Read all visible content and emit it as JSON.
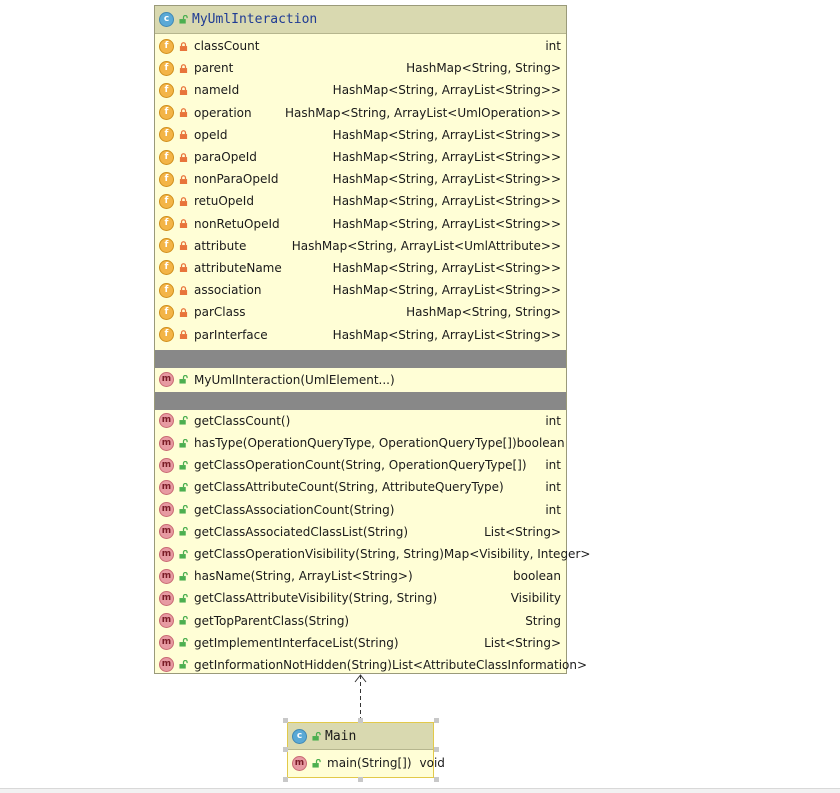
{
  "classes": [
    {
      "title": "MyUmlInteraction",
      "fields": [
        {
          "name": "classCount",
          "type": "int"
        },
        {
          "name": "parent",
          "type": "HashMap<String, String>"
        },
        {
          "name": "nameId",
          "type": "HashMap<String, ArrayList<String>>"
        },
        {
          "name": "operation",
          "type": "HashMap<String, ArrayList<UmlOperation>>"
        },
        {
          "name": "opeId",
          "type": "HashMap<String, ArrayList<String>>"
        },
        {
          "name": "paraOpeId",
          "type": "HashMap<String, ArrayList<String>>"
        },
        {
          "name": "nonParaOpeId",
          "type": "HashMap<String, ArrayList<String>>"
        },
        {
          "name": "retuOpeId",
          "type": "HashMap<String, ArrayList<String>>"
        },
        {
          "name": "nonRetuOpeId",
          "type": "HashMap<String, ArrayList<String>>"
        },
        {
          "name": "attribute",
          "type": "HashMap<String, ArrayList<UmlAttribute>>"
        },
        {
          "name": "attributeName",
          "type": "HashMap<String, ArrayList<String>>"
        },
        {
          "name": "association",
          "type": "HashMap<String, ArrayList<String>>"
        },
        {
          "name": "parClass",
          "type": "HashMap<String, String>"
        },
        {
          "name": "parInterface",
          "type": "HashMap<String, ArrayList<String>>"
        }
      ],
      "constructors": [
        {
          "name": "MyUmlInteraction(UmlElement...)",
          "type": ""
        }
      ],
      "methods": [
        {
          "name": "getClassCount()",
          "type": "int"
        },
        {
          "name": "hasType(OperationQueryType, OperationQueryType[])",
          "type": "boolean"
        },
        {
          "name": "getClassOperationCount(String, OperationQueryType[])",
          "type": "int"
        },
        {
          "name": "getClassAttributeCount(String, AttributeQueryType)",
          "type": "int"
        },
        {
          "name": "getClassAssociationCount(String)",
          "type": "int"
        },
        {
          "name": "getClassAssociatedClassList(String)",
          "type": "List<String>"
        },
        {
          "name": "getClassOperationVisibility(String, String)",
          "type": "Map<Visibility, Integer>"
        },
        {
          "name": "hasName(String, ArrayList<String>)",
          "type": "boolean"
        },
        {
          "name": "getClassAttributeVisibility(String, String)",
          "type": "Visibility"
        },
        {
          "name": "getTopParentClass(String)",
          "type": "String"
        },
        {
          "name": "getImplementInterfaceList(String)",
          "type": "List<String>"
        },
        {
          "name": "getInformationNotHidden(String)",
          "type": "List<AttributeClassInformation>"
        }
      ]
    },
    {
      "title": "Main",
      "methods": [
        {
          "name": "main(String[])",
          "type": "void"
        }
      ]
    }
  ],
  "badges": {
    "class": "c",
    "field": "f",
    "method": "m"
  },
  "colors": {
    "box_fill": "#fffed6",
    "header_fill": "#d9d9b0",
    "separator": "#888888",
    "title_blue": "#1f3b94",
    "field_badge": "#f3b447",
    "method_badge": "#e79aa2",
    "class_badge": "#5aa9d6",
    "private_lock": "#e8743b",
    "public_open": "#4caf50"
  },
  "relations": [
    {
      "from": "Main",
      "to": "MyUmlInteraction",
      "kind": "dependency",
      "style": "dashed",
      "arrow": "open"
    }
  ]
}
